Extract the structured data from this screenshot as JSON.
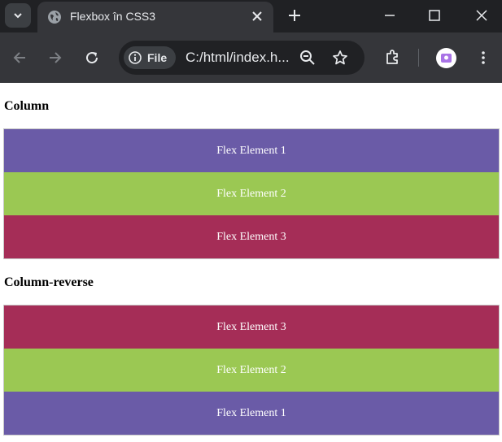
{
  "browser": {
    "tab_title": "Flexbox în CSS3",
    "url_chip_label": "File",
    "url": "C:/html/index.h..."
  },
  "icons": {
    "tab_search": "chevron-down-icon",
    "favicon": "globe-icon",
    "tab_close": "close-icon",
    "new_tab": "plus-icon",
    "minimize": "minimize-icon",
    "maximize": "maximize-icon",
    "close_window": "close-icon",
    "back": "arrow-left-icon",
    "forward": "arrow-right-icon",
    "reload": "reload-icon",
    "site_info": "info-icon",
    "zoom": "zoom-out-icon",
    "bookmark": "star-icon",
    "extensions": "puzzle-icon",
    "profile": "avatar",
    "menu": "kebab-menu-icon"
  },
  "colors": {
    "purple": "#6a5ba7",
    "green": "#9bc853",
    "crimson": "#a52d57"
  },
  "page": {
    "section_column": {
      "heading": "Column",
      "items": [
        {
          "label": "Flex Element 1",
          "color": "#6a5ba7"
        },
        {
          "label": "Flex Element 2",
          "color": "#9bc853"
        },
        {
          "label": "Flex Element 3",
          "color": "#a52d57"
        }
      ]
    },
    "section_column_reverse": {
      "heading": "Column-reverse",
      "items": [
        {
          "label": "Flex Element 1",
          "color": "#6a5ba7"
        },
        {
          "label": "Flex Element 2",
          "color": "#9bc853"
        },
        {
          "label": "Flex Element 3",
          "color": "#a52d57"
        }
      ]
    }
  }
}
